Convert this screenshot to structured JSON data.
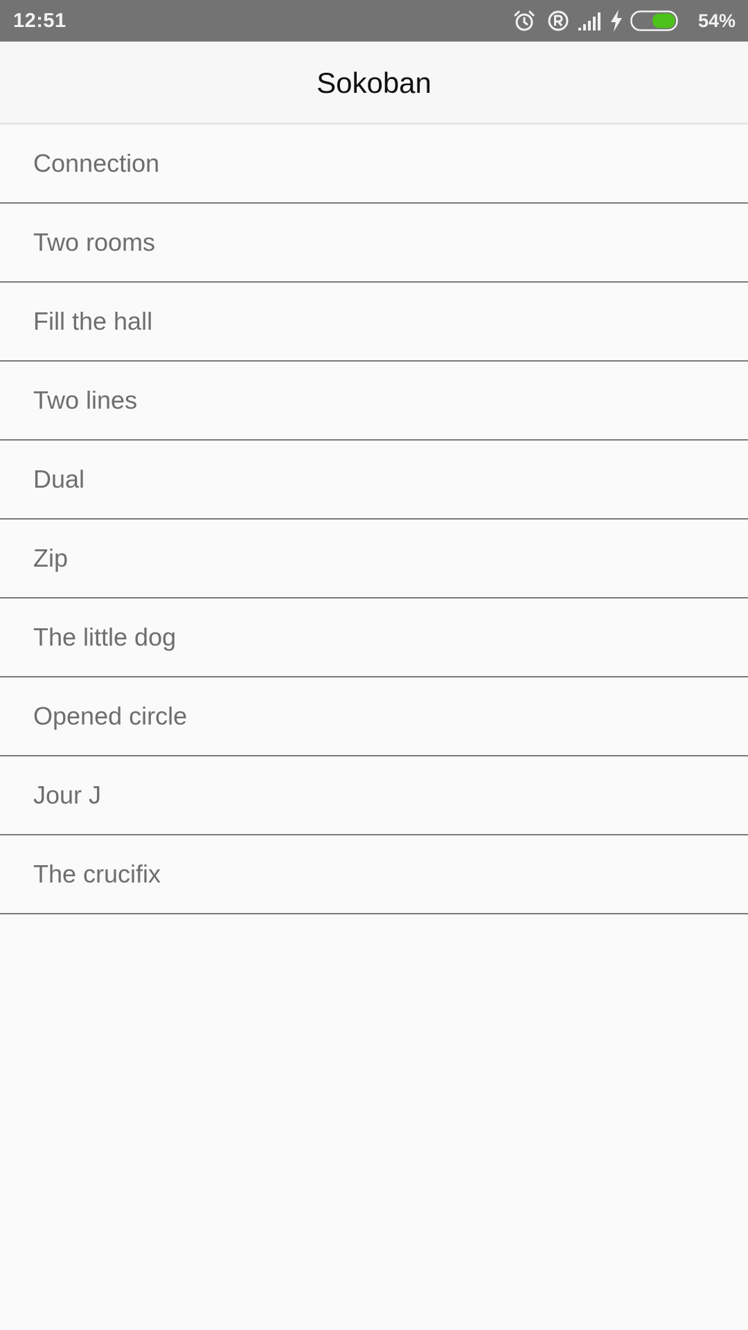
{
  "status_bar": {
    "time": "12:51",
    "battery_percent": "54%",
    "battery_level": 0.54,
    "battery_color": "#4cc21a",
    "icons": [
      "alarm-icon",
      "registered-icon",
      "signal-icon",
      "charging-icon",
      "battery-icon"
    ]
  },
  "header": {
    "title": "Sokoban"
  },
  "levels": [
    {
      "label": "Connection"
    },
    {
      "label": "Two rooms"
    },
    {
      "label": "Fill the hall"
    },
    {
      "label": "Two lines"
    },
    {
      "label": "Dual"
    },
    {
      "label": "Zip"
    },
    {
      "label": "The little dog"
    },
    {
      "label": "Opened circle"
    },
    {
      "label": "Jour J"
    },
    {
      "label": "The crucifix"
    }
  ]
}
